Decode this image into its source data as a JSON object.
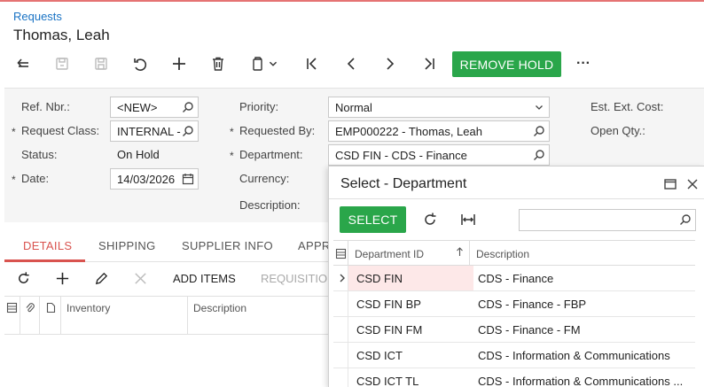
{
  "header": {
    "breadcrumb": "Requests",
    "title": "Thomas, Leah"
  },
  "toolbar": {
    "remove_hold_label": "REMOVE HOLD",
    "more_label": "···",
    "accent": "#2aa64a"
  },
  "form": {
    "ref_nbr_label": "Ref. Nbr.:",
    "ref_nbr_value": "<NEW>",
    "request_class_label": "Request Class:",
    "request_class_value": "INTERNAL -",
    "status_label": "Status:",
    "status_value": "On Hold",
    "date_label": "Date:",
    "date_value": "14/03/2026",
    "priority_label": "Priority:",
    "priority_value": "Normal",
    "requested_by_label": "Requested By:",
    "requested_by_value": "EMP000222 - Thomas, Leah",
    "department_label": "Department:",
    "department_value": "CSD FIN - CDS - Finance",
    "currency_label": "Currency:",
    "description_label": "Description:",
    "est_ext_cost_label": "Est. Ext. Cost:",
    "open_qty_label": "Open Qty.:",
    "required_marker": "*"
  },
  "tabs": [
    "DETAILS",
    "SHIPPING",
    "SUPPLIER INFO",
    "APPR"
  ],
  "grid_toolbar": {
    "add_items_label": "ADD ITEMS",
    "requisition_label": "REQUISITIO"
  },
  "grid": {
    "columns": [
      "Inventory",
      "Description"
    ]
  },
  "popup": {
    "title": "Select - Department",
    "select_label": "SELECT",
    "search_placeholder": "",
    "columns": [
      "Department ID",
      "Description"
    ],
    "rows": [
      {
        "id": "CSD FIN",
        "description": "CDS - Finance"
      },
      {
        "id": "CSD FIN BP",
        "description": "CDS - Finance - FBP"
      },
      {
        "id": "CSD FIN FM",
        "description": "CDS - Finance - FM"
      },
      {
        "id": "CSD ICT",
        "description": "CDS - Information & Communications"
      },
      {
        "id": "CSD ICT TL",
        "description": "CDS - Information & Communications ..."
      }
    ]
  }
}
